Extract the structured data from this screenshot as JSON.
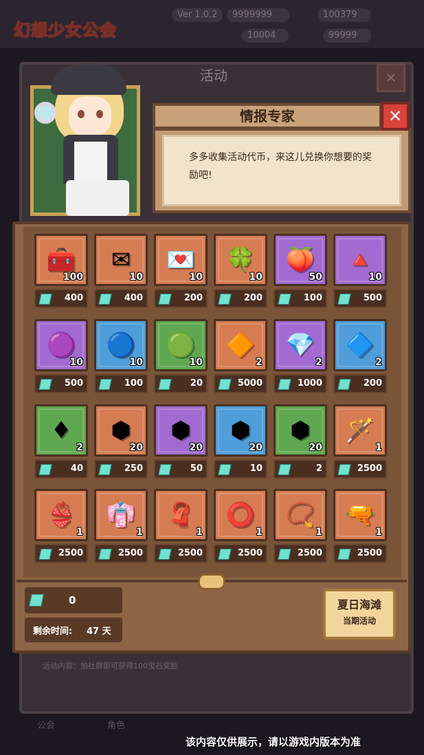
{
  "background": {
    "version_text": "Ver 1.0.2",
    "resources": [
      "9999999",
      "100379",
      "10004",
      "99999"
    ],
    "window_title": "活动",
    "footer_text": "活动内容：加社群即可获得100宝石奖励",
    "nav": [
      "公会",
      "角色"
    ]
  },
  "logo": {
    "text_main": "幻想",
    "text_pink": "少女",
    "text_end": "公会"
  },
  "dialog": {
    "title": "情报专家",
    "close_label": "✕",
    "message": "多多收集活动代币，来这儿兑换你想要的奖励吧!"
  },
  "shop": {
    "items": [
      {
        "icon": "treasure-chest-icon",
        "glyph": "🧰",
        "color": "orange",
        "qty": "100",
        "price": "400"
      },
      {
        "icon": "dark-envelope-icon",
        "glyph": "✉",
        "color": "orange",
        "qty": "10",
        "price": "400"
      },
      {
        "icon": "love-letter-icon",
        "glyph": "💌",
        "color": "orange",
        "qty": "10",
        "price": "200"
      },
      {
        "icon": "four-leaf-clover-icon",
        "glyph": "🍀",
        "color": "orange",
        "qty": "10",
        "price": "200"
      },
      {
        "icon": "peach-fruit-icon",
        "glyph": "🍑",
        "color": "purple",
        "qty": "50",
        "price": "100"
      },
      {
        "icon": "pink-pyramid-gem-icon",
        "glyph": "🔺",
        "color": "purple",
        "qty": "10",
        "price": "500"
      },
      {
        "icon": "magenta-round-gem-icon",
        "glyph": "🟣",
        "color": "purple",
        "qty": "10",
        "price": "500"
      },
      {
        "icon": "blue-round-gem-icon",
        "glyph": "🔵",
        "color": "blue",
        "qty": "10",
        "price": "100"
      },
      {
        "icon": "green-round-gem-icon",
        "glyph": "🟢",
        "color": "green",
        "qty": "10",
        "price": "20"
      },
      {
        "icon": "amber-crystal-icon",
        "glyph": "🔶",
        "color": "orange",
        "qty": "2",
        "price": "5000"
      },
      {
        "icon": "pink-crystal-icon",
        "glyph": "💎",
        "color": "purple",
        "qty": "2",
        "price": "1000"
      },
      {
        "icon": "blue-crystal-icon",
        "glyph": "🔷",
        "color": "blue",
        "qty": "2",
        "price": "200"
      },
      {
        "icon": "green-crystal-icon",
        "glyph": "♦",
        "color": "green",
        "qty": "2",
        "price": "40"
      },
      {
        "icon": "gold-hex-gem-icon",
        "glyph": "⬢",
        "color": "orange",
        "qty": "20",
        "price": "250"
      },
      {
        "icon": "violet-hex-gem-icon",
        "glyph": "⬢",
        "color": "purple",
        "qty": "20",
        "price": "50"
      },
      {
        "icon": "cyan-hex-gem-icon",
        "glyph": "⬢",
        "color": "blue",
        "qty": "20",
        "price": "10"
      },
      {
        "icon": "olive-hex-gem-icon",
        "glyph": "⬢",
        "color": "green",
        "qty": "20",
        "price": "2"
      },
      {
        "icon": "magic-wand-icon",
        "glyph": "🪄",
        "color": "orange",
        "qty": "1",
        "price": "2500"
      },
      {
        "icon": "bikini-top-icon",
        "glyph": "👙",
        "color": "orange",
        "qty": "1",
        "price": "2500"
      },
      {
        "icon": "purple-swimsuit-icon",
        "glyph": "👘",
        "color": "orange",
        "qty": "1",
        "price": "2500"
      },
      {
        "icon": "purple-scarf-icon",
        "glyph": "🧣",
        "color": "orange",
        "qty": "1",
        "price": "2500"
      },
      {
        "icon": "choker-collar-icon",
        "glyph": "⭕",
        "color": "orange",
        "qty": "1",
        "price": "2500"
      },
      {
        "icon": "heart-necklace-icon",
        "glyph": "📿",
        "color": "orange",
        "qty": "1",
        "price": "2500"
      },
      {
        "icon": "water-gun-icon",
        "glyph": "🔫",
        "color": "orange",
        "qty": "1",
        "price": "2500"
      }
    ]
  },
  "footer": {
    "balance": "0",
    "time_label": "剩余时间:",
    "time_value": "47 天",
    "event_name": "夏日海滩",
    "event_sub": "当期活动"
  },
  "disclaimer": "该内容仅供展示，请以游戏内版本为准",
  "colors": {
    "orange": "#d57c52",
    "purple": "#a26bd1",
    "blue": "#4f9ed9",
    "green": "#5fa851",
    "token": "#6fe3d0"
  }
}
